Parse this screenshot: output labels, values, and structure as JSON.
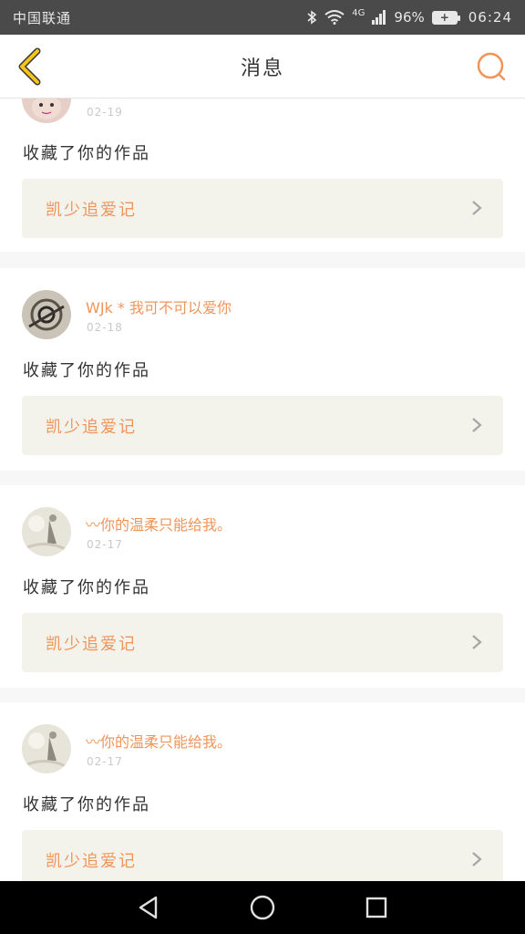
{
  "status_bar": {
    "carrier": "中国联通",
    "network": "4G",
    "battery": "96%",
    "time": "06:24"
  },
  "header": {
    "title": "消息",
    "back_icon": "chevron-left-icon",
    "search_icon": "search-icon"
  },
  "colors": {
    "accent": "#f0955a",
    "back_arrow": "#f5c518",
    "work_card_bg": "#f3f3ec"
  },
  "messages": [
    {
      "username": "",
      "date": "02-19",
      "action": "收藏了你的作品",
      "work_title": "凯少追爱记"
    },
    {
      "username": "WJk * 我可不可以爱你",
      "date": "02-18",
      "action": "收藏了你的作品",
      "work_title": "凯少追爱记"
    },
    {
      "username": "〰你的温柔只能给我。",
      "date": "02-17",
      "action": "收藏了你的作品",
      "work_title": "凯少追爱记"
    },
    {
      "username": "〰你的温柔只能给我。",
      "date": "02-17",
      "action": "收藏了你的作品",
      "work_title": "凯少追爱记"
    }
  ],
  "nav": {
    "back_icon": "triangle-back-icon",
    "home_icon": "circle-home-icon",
    "recents_icon": "square-recents-icon"
  }
}
